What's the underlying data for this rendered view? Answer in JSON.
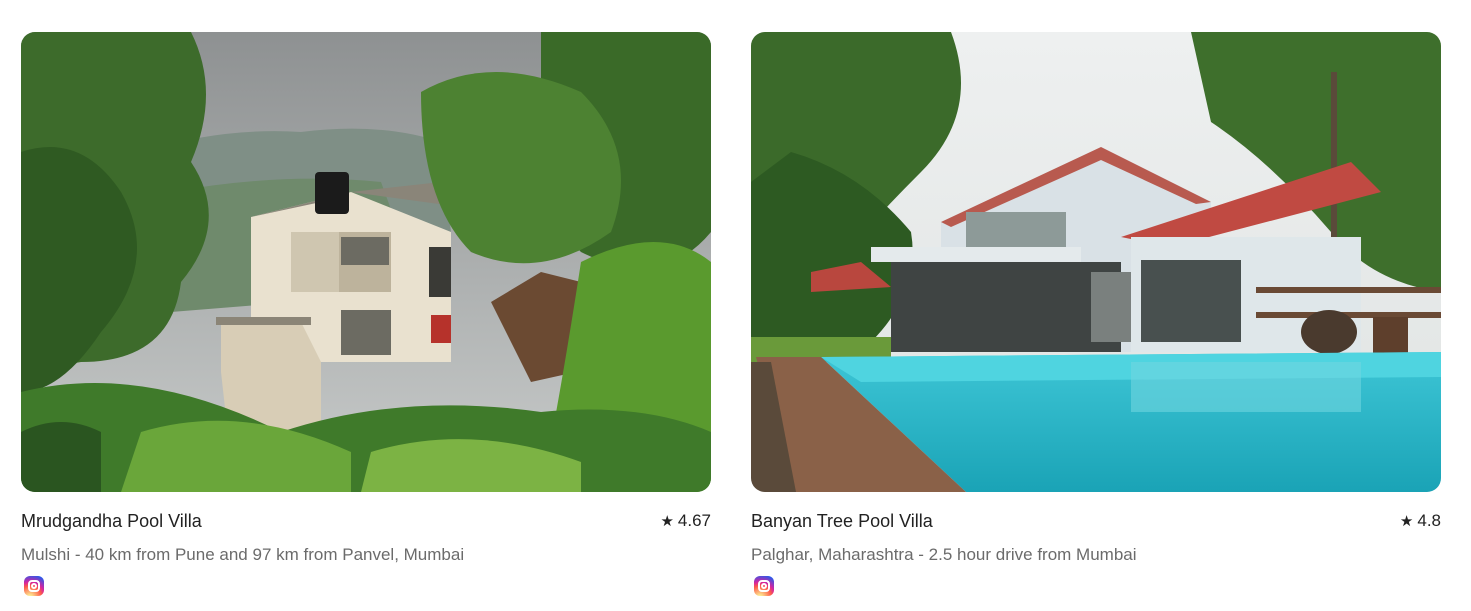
{
  "listings": [
    {
      "title": "Mrudgandha Pool Villa",
      "rating": "4.67",
      "star": "★",
      "subtitle": "Mulshi - 40 km from Pune and 97 km from Panvel, Mumbai",
      "social_icon": "instagram-icon"
    },
    {
      "title": "Banyan Tree Pool Villa",
      "rating": "4.8",
      "star": "★",
      "subtitle": "Palghar, Maharashtra - 2.5 hour drive from Mumbai",
      "social_icon": "instagram-icon"
    }
  ]
}
